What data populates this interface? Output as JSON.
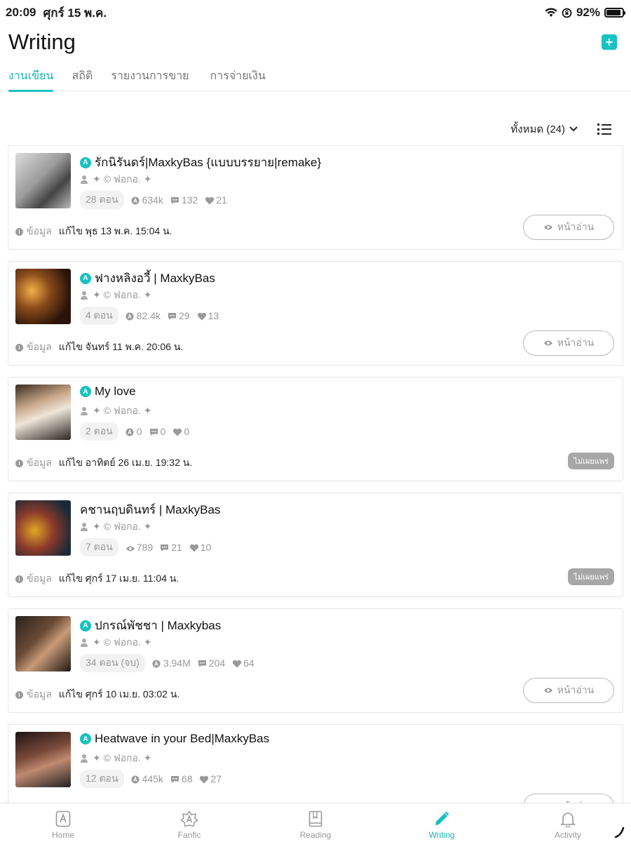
{
  "status_bar": {
    "time": "20:09",
    "date": "ศุกร์ 15 พ.ค.",
    "battery": "92%",
    "battery_level": 0.92
  },
  "header": {
    "title": "Writing"
  },
  "tabs": [
    {
      "label": "งานเขียน",
      "active": true
    },
    {
      "label": "สถิติ",
      "active": false
    },
    {
      "label": "รายงานการขาย",
      "active": false
    },
    {
      "label": "การจ่ายเงิน",
      "active": false
    }
  ],
  "filter": {
    "label": "ทั้งหมด (24)"
  },
  "colors": {
    "accent": "#17c2c0",
    "text": "#111111",
    "muted": "#999999"
  },
  "labels": {
    "info": "ข้อมูล",
    "read": "หน้าอ่าน",
    "unpublished": "ไม่เผยแพร่"
  },
  "works": [
    {
      "title": "รักนิรันดร์|MaxkyBas {แบบบรรยาย|remake}",
      "has_badge": true,
      "author": "✦ © ฟอกอ. ✦",
      "episodes": "28 ตอน",
      "views_icon": "a-badge-icon",
      "views": "634k",
      "comments": "132",
      "likes": "21",
      "edited": "แก้ไข พุธ 13 พ.ค. 15:04 น.",
      "status": "read"
    },
    {
      "title": "ฟางหลิงอวี้ | MaxkyBas",
      "has_badge": true,
      "author": "✦ © ฟอกอ. ✦",
      "episodes": "4 ตอน",
      "views_icon": "a-badge-icon",
      "views": "82.4k",
      "comments": "29",
      "likes": "13",
      "edited": "แก้ไข จันทร์ 11 พ.ค. 20:06 น.",
      "status": "read"
    },
    {
      "title": "My love",
      "has_badge": true,
      "author": "✦ © ฟอกอ. ✦",
      "episodes": "2 ตอน",
      "views_icon": "a-badge-icon",
      "views": "0",
      "comments": "0",
      "likes": "0",
      "edited": "แก้ไข อาทิตย์ 26 เม.ย. 19:32 น.",
      "status": "unpublished"
    },
    {
      "title": "คชานฤบดินทร์ | MaxkyBas",
      "has_badge": false,
      "author": "✦ © ฟอกอ. ✦",
      "episodes": "7 ตอน",
      "views_icon": "eye-icon",
      "views": "789",
      "comments": "21",
      "likes": "10",
      "edited": "แก้ไข ศุกร์ 17 เม.ย. 11:04 น.",
      "status": "unpublished"
    },
    {
      "title": "ปกรณ์พัชชา  | Maxkybas",
      "has_badge": true,
      "author": "✦ © ฟอกอ. ✦",
      "episodes": "34 ตอน (จบ)",
      "views_icon": "a-badge-icon",
      "views": "3.94M",
      "comments": "204",
      "likes": "64",
      "edited": "แก้ไข ศุกร์ 10 เม.ย. 03:02 น.",
      "status": "read"
    },
    {
      "title": "Heatwave in your Bed|MaxkyBas",
      "has_badge": true,
      "author": "✦ © ฟอกอ. ✦",
      "episodes": "12 ตอน",
      "views_icon": "a-badge-icon",
      "views": "445k",
      "comments": "68",
      "likes": "27",
      "edited": "",
      "status": "read"
    }
  ],
  "bottom_nav": [
    {
      "label": "Home",
      "icon": "home-a-icon",
      "active": false
    },
    {
      "label": "Fanfic",
      "icon": "fanfic-a-icon",
      "active": false
    },
    {
      "label": "Reading",
      "icon": "book-icon",
      "active": false
    },
    {
      "label": "Writing",
      "icon": "pencil-icon",
      "active": true
    },
    {
      "label": "Activity",
      "icon": "bell-icon",
      "active": false
    }
  ]
}
